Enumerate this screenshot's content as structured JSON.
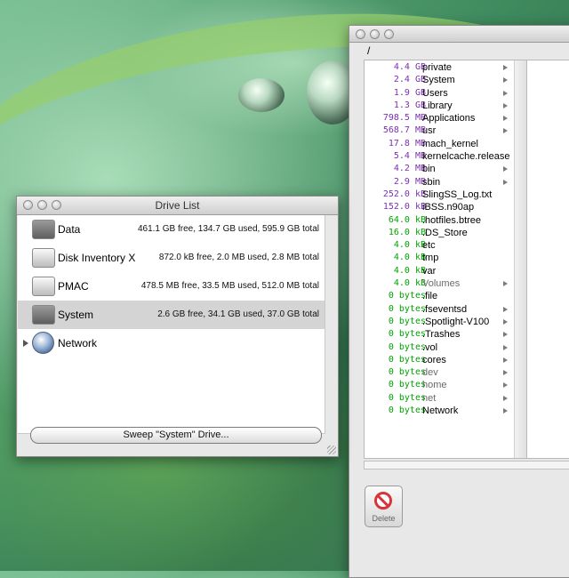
{
  "colors": {
    "size_green": "#00a400",
    "size_purple": "#7a30b0",
    "dim_text": "#6a6a6a"
  },
  "drive_window": {
    "title": "Drive List",
    "drives": [
      {
        "name": "Data",
        "info": "461.1 GB free, 134.7 GB used, 595.9 GB total",
        "icon": "hard-drive-icon",
        "selected": false
      },
      {
        "name": "Disk Inventory X",
        "info": "872.0 kB free, 2.0 MB used, 2.8 MB total",
        "icon": "disk-image-icon",
        "selected": false
      },
      {
        "name": "PMAC",
        "info": "478.5 MB free, 33.5 MB used, 512.0 MB total",
        "icon": "disk-image-icon",
        "selected": false
      },
      {
        "name": "System",
        "info": "2.6 GB free, 34.1 GB used, 37.0 GB total",
        "icon": "hard-drive-icon",
        "selected": true
      },
      {
        "name": "Network",
        "info": "",
        "icon": "network-globe-icon",
        "selected": false
      }
    ],
    "sweep_button": "Sweep \"System\" Drive..."
  },
  "browser_window": {
    "path": "/",
    "files": [
      {
        "size": "4.4 GB",
        "name": "private",
        "folder": true,
        "color": "purple"
      },
      {
        "size": "2.4 GB",
        "name": "System",
        "folder": true,
        "color": "purple"
      },
      {
        "size": "1.9 GB",
        "name": "Users",
        "folder": true,
        "color": "purple"
      },
      {
        "size": "1.3 GB",
        "name": "Library",
        "folder": true,
        "color": "purple"
      },
      {
        "size": "798.5 MB",
        "name": "Applications",
        "folder": true,
        "color": "purple"
      },
      {
        "size": "568.7 MB",
        "name": "usr",
        "folder": true,
        "color": "purple"
      },
      {
        "size": "17.8 MB",
        "name": "mach_kernel",
        "folder": false,
        "color": "purple"
      },
      {
        "size": "5.4 MB",
        "name": "kernelcache.release",
        "folder": false,
        "color": "purple"
      },
      {
        "size": "4.2 MB",
        "name": "bin",
        "folder": true,
        "color": "purple"
      },
      {
        "size": "2.9 MB",
        "name": "sbin",
        "folder": true,
        "color": "purple"
      },
      {
        "size": "252.0 kB",
        "name": "SlingSS_Log.txt",
        "folder": false,
        "color": "purple"
      },
      {
        "size": "152.0 kB",
        "name": "iBSS.n90ap",
        "folder": false,
        "color": "purple"
      },
      {
        "size": "64.0 kB",
        "name": ".hotfiles.btree",
        "folder": false,
        "color": "green"
      },
      {
        "size": "16.0 kB",
        "name": ".DS_Store",
        "folder": false,
        "color": "green"
      },
      {
        "size": "4.0 kB",
        "name": "etc",
        "folder": false,
        "color": "green"
      },
      {
        "size": "4.0 kB",
        "name": "tmp",
        "folder": false,
        "color": "green"
      },
      {
        "size": "4.0 kB",
        "name": "var",
        "folder": false,
        "color": "green"
      },
      {
        "size": "4.0 kB",
        "name": "Volumes",
        "folder": true,
        "color": "green",
        "dim": true
      },
      {
        "size": "0 bytes",
        "name": ".file",
        "folder": false,
        "color": "green"
      },
      {
        "size": "0 bytes",
        "name": ".fseventsd",
        "folder": true,
        "color": "green"
      },
      {
        "size": "0 bytes",
        "name": ".Spotlight-V100",
        "folder": true,
        "color": "green"
      },
      {
        "size": "0 bytes",
        "name": ".Trashes",
        "folder": true,
        "color": "green"
      },
      {
        "size": "0 bytes",
        "name": ".vol",
        "folder": true,
        "color": "green"
      },
      {
        "size": "0 bytes",
        "name": "cores",
        "folder": true,
        "color": "green"
      },
      {
        "size": "0 bytes",
        "name": "dev",
        "folder": true,
        "color": "green",
        "dim": true
      },
      {
        "size": "0 bytes",
        "name": "home",
        "folder": true,
        "color": "green",
        "dim": true
      },
      {
        "size": "0 bytes",
        "name": "net",
        "folder": true,
        "color": "green",
        "dim": true
      },
      {
        "size": "0 bytes",
        "name": "Network",
        "folder": true,
        "color": "green"
      }
    ],
    "delete_button": "Delete"
  }
}
